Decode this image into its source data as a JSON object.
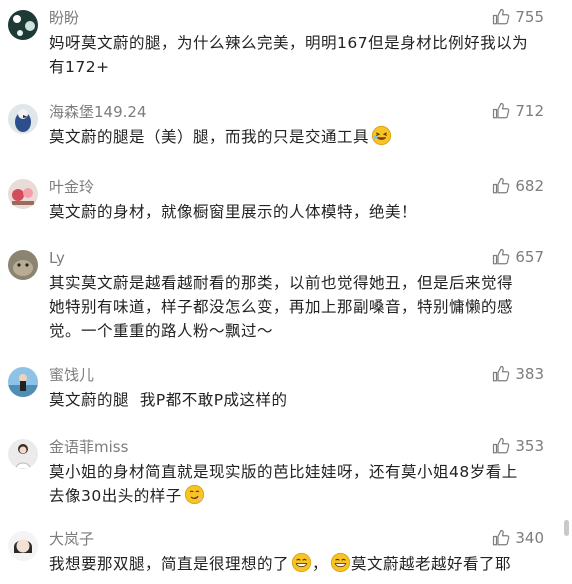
{
  "comments": [
    {
      "user": "盼盼",
      "likes": "755",
      "lines": [
        "妈呀莫文蔚的腿，为什么辣么完美，明明167但是身材比例好我以为",
        "有172+"
      ],
      "emoji": ""
    },
    {
      "user": "海森堡149.24",
      "likes": "712",
      "lines": [
        "莫文蔚的腿是（美）腿，而我的只是交通工具"
      ],
      "emoji": "laughing-emoji"
    },
    {
      "user": "叶金玲",
      "likes": "682",
      "lines": [
        "莫文蔚的身材，就像橱窗里展示的人体模特，绝美！"
      ],
      "emoji": ""
    },
    {
      "user": "Ly",
      "likes": "657",
      "lines": [
        "其实莫文蔚是越看越耐看的那类，以前也觉得她丑，但是后来觉得",
        "她特别有味道，样子都没怎么变，再加上那副嗓音，特别慵懒的感",
        "觉。一个重重的路人粉～飘过～"
      ],
      "emoji": ""
    },
    {
      "user": "蜜饯儿",
      "likes": "383",
      "lines": [
        "莫文蔚的腿  我P都不敢P成这样的"
      ],
      "emoji": ""
    },
    {
      "user": "金语菲miss",
      "likes": "353",
      "lines": [
        "莫小姐的身材简直就是现实版的芭比娃娃呀，还有莫小姐48岁看上",
        "去像30出头的样子"
      ],
      "emoji": "smirk-emoji"
    },
    {
      "user": "大岚子",
      "likes": "340",
      "lines": [
        "我想要那双腿，简直是很理想的了",
        "，",
        "莫文蔚越老越好看了耶"
      ],
      "emoji": "grin-emoji"
    }
  ],
  "colors": {
    "text": "#222222",
    "meta": "#7d7d7d",
    "emoji": "#f7c325"
  }
}
